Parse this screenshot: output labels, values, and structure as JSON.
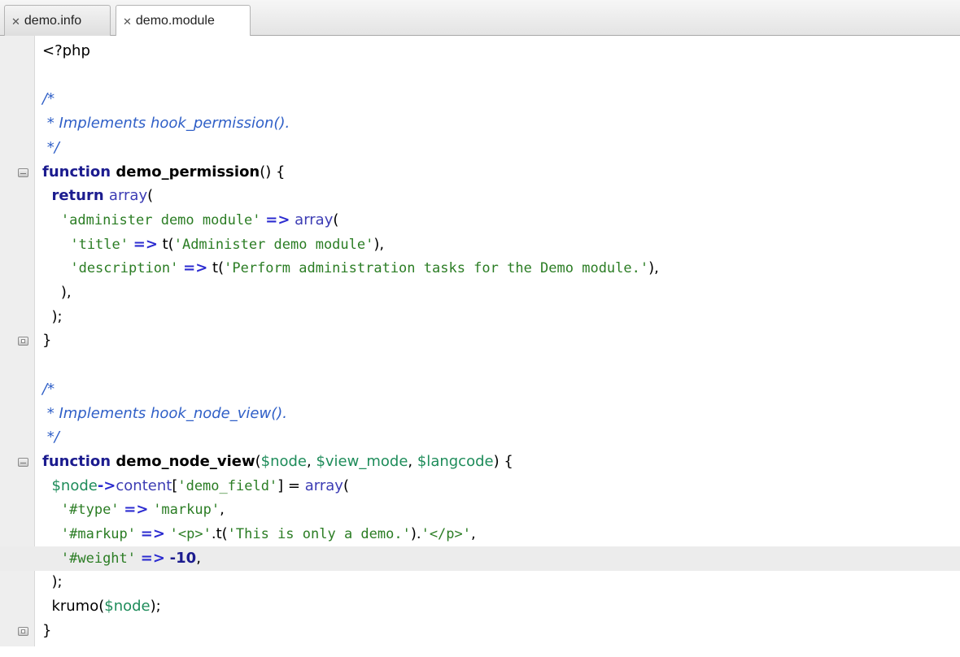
{
  "tabs": [
    {
      "close_glyph": "✕",
      "label": "demo.info"
    },
    {
      "close_glyph": "✕",
      "label": "demo.module",
      "active": true
    }
  ],
  "current_line": 21,
  "lines": [
    {
      "fold": null,
      "tokens": [
        {
          "c": "punc",
          "t": "<?php"
        }
      ]
    },
    {
      "fold": null,
      "tokens": []
    },
    {
      "fold": null,
      "tokens": [
        {
          "c": "com",
          "t": "/*"
        }
      ]
    },
    {
      "fold": null,
      "tokens": [
        {
          "c": "com",
          "t": " * Implements hook_permission()."
        }
      ]
    },
    {
      "fold": null,
      "tokens": [
        {
          "c": "com",
          "t": " */"
        }
      ]
    },
    {
      "fold": "open",
      "tokens": [
        {
          "c": "kw",
          "t": "function "
        },
        {
          "c": "fn",
          "t": "demo_permission"
        },
        {
          "c": "punc",
          "t": "() {"
        }
      ]
    },
    {
      "fold": null,
      "tokens": [
        {
          "c": "punc",
          "t": "  "
        },
        {
          "c": "kw",
          "t": "return "
        },
        {
          "c": "bi",
          "t": "array"
        },
        {
          "c": "punc",
          "t": "("
        }
      ]
    },
    {
      "fold": null,
      "tokens": [
        {
          "c": "punc",
          "t": "    "
        },
        {
          "c": "str",
          "t": "'administer demo module'"
        },
        {
          "c": "punc",
          "t": " "
        },
        {
          "c": "op",
          "t": "=>"
        },
        {
          "c": "punc",
          "t": " "
        },
        {
          "c": "bi",
          "t": "array"
        },
        {
          "c": "punc",
          "t": "("
        }
      ]
    },
    {
      "fold": null,
      "tokens": [
        {
          "c": "punc",
          "t": "      "
        },
        {
          "c": "str",
          "t": "'title'"
        },
        {
          "c": "punc",
          "t": " "
        },
        {
          "c": "op",
          "t": "=>"
        },
        {
          "c": "punc",
          "t": " t("
        },
        {
          "c": "str",
          "t": "'Administer demo module'"
        },
        {
          "c": "punc",
          "t": "),"
        }
      ]
    },
    {
      "fold": null,
      "tokens": [
        {
          "c": "punc",
          "t": "      "
        },
        {
          "c": "str",
          "t": "'description'"
        },
        {
          "c": "punc",
          "t": " "
        },
        {
          "c": "op",
          "t": "=>"
        },
        {
          "c": "punc",
          "t": " t("
        },
        {
          "c": "str",
          "t": "'Perform administration tasks for the Demo module.'"
        },
        {
          "c": "punc",
          "t": "),"
        }
      ]
    },
    {
      "fold": null,
      "tokens": [
        {
          "c": "punc",
          "t": "    ),"
        }
      ]
    },
    {
      "fold": null,
      "tokens": [
        {
          "c": "punc",
          "t": "  );"
        }
      ]
    },
    {
      "fold": "close",
      "tokens": [
        {
          "c": "punc",
          "t": "}"
        }
      ]
    },
    {
      "fold": null,
      "tokens": []
    },
    {
      "fold": null,
      "tokens": [
        {
          "c": "com",
          "t": "/*"
        }
      ]
    },
    {
      "fold": null,
      "tokens": [
        {
          "c": "com",
          "t": " * Implements hook_node_view()."
        }
      ]
    },
    {
      "fold": null,
      "tokens": [
        {
          "c": "com",
          "t": " */"
        }
      ]
    },
    {
      "fold": "open",
      "tokens": [
        {
          "c": "kw",
          "t": "function "
        },
        {
          "c": "fn",
          "t": "demo_node_view"
        },
        {
          "c": "punc",
          "t": "("
        },
        {
          "c": "var",
          "t": "$node"
        },
        {
          "c": "punc",
          "t": ", "
        },
        {
          "c": "var",
          "t": "$view_mode"
        },
        {
          "c": "punc",
          "t": ", "
        },
        {
          "c": "var",
          "t": "$langcode"
        },
        {
          "c": "punc",
          "t": ") {"
        }
      ]
    },
    {
      "fold": null,
      "tokens": [
        {
          "c": "punc",
          "t": "  "
        },
        {
          "c": "var",
          "t": "$node"
        },
        {
          "c": "op",
          "t": "->"
        },
        {
          "c": "bi",
          "t": "content"
        },
        {
          "c": "punc",
          "t": "["
        },
        {
          "c": "str",
          "t": "'demo_field'"
        },
        {
          "c": "punc",
          "t": "] = "
        },
        {
          "c": "bi",
          "t": "array"
        },
        {
          "c": "punc",
          "t": "("
        }
      ]
    },
    {
      "fold": null,
      "tokens": [
        {
          "c": "punc",
          "t": "    "
        },
        {
          "c": "str",
          "t": "'#type'"
        },
        {
          "c": "punc",
          "t": " "
        },
        {
          "c": "op",
          "t": "=>"
        },
        {
          "c": "punc",
          "t": " "
        },
        {
          "c": "str",
          "t": "'markup'"
        },
        {
          "c": "punc",
          "t": ","
        }
      ]
    },
    {
      "fold": null,
      "tokens": [
        {
          "c": "punc",
          "t": "    "
        },
        {
          "c": "str",
          "t": "'#markup'"
        },
        {
          "c": "punc",
          "t": " "
        },
        {
          "c": "op",
          "t": "=>"
        },
        {
          "c": "punc",
          "t": " "
        },
        {
          "c": "str",
          "t": "'<p>'"
        },
        {
          "c": "punc",
          "t": ".t("
        },
        {
          "c": "str",
          "t": "'This is only a demo.'"
        },
        {
          "c": "punc",
          "t": ")."
        },
        {
          "c": "str",
          "t": "'</p>'"
        },
        {
          "c": "punc",
          "t": ","
        }
      ]
    },
    {
      "fold": null,
      "tokens": [
        {
          "c": "punc",
          "t": "    "
        },
        {
          "c": "str",
          "t": "'#weight'"
        },
        {
          "c": "punc",
          "t": " "
        },
        {
          "c": "op",
          "t": "=>"
        },
        {
          "c": "punc",
          "t": " "
        },
        {
          "c": "num",
          "t": "-10"
        },
        {
          "c": "punc",
          "t": ","
        }
      ]
    },
    {
      "fold": null,
      "tokens": [
        {
          "c": "punc",
          "t": "  );"
        }
      ]
    },
    {
      "fold": null,
      "tokens": [
        {
          "c": "punc",
          "t": "  krumo("
        },
        {
          "c": "var",
          "t": "$node"
        },
        {
          "c": "punc",
          "t": ");"
        }
      ]
    },
    {
      "fold": "close",
      "tokens": [
        {
          "c": "punc",
          "t": "}"
        }
      ]
    }
  ]
}
